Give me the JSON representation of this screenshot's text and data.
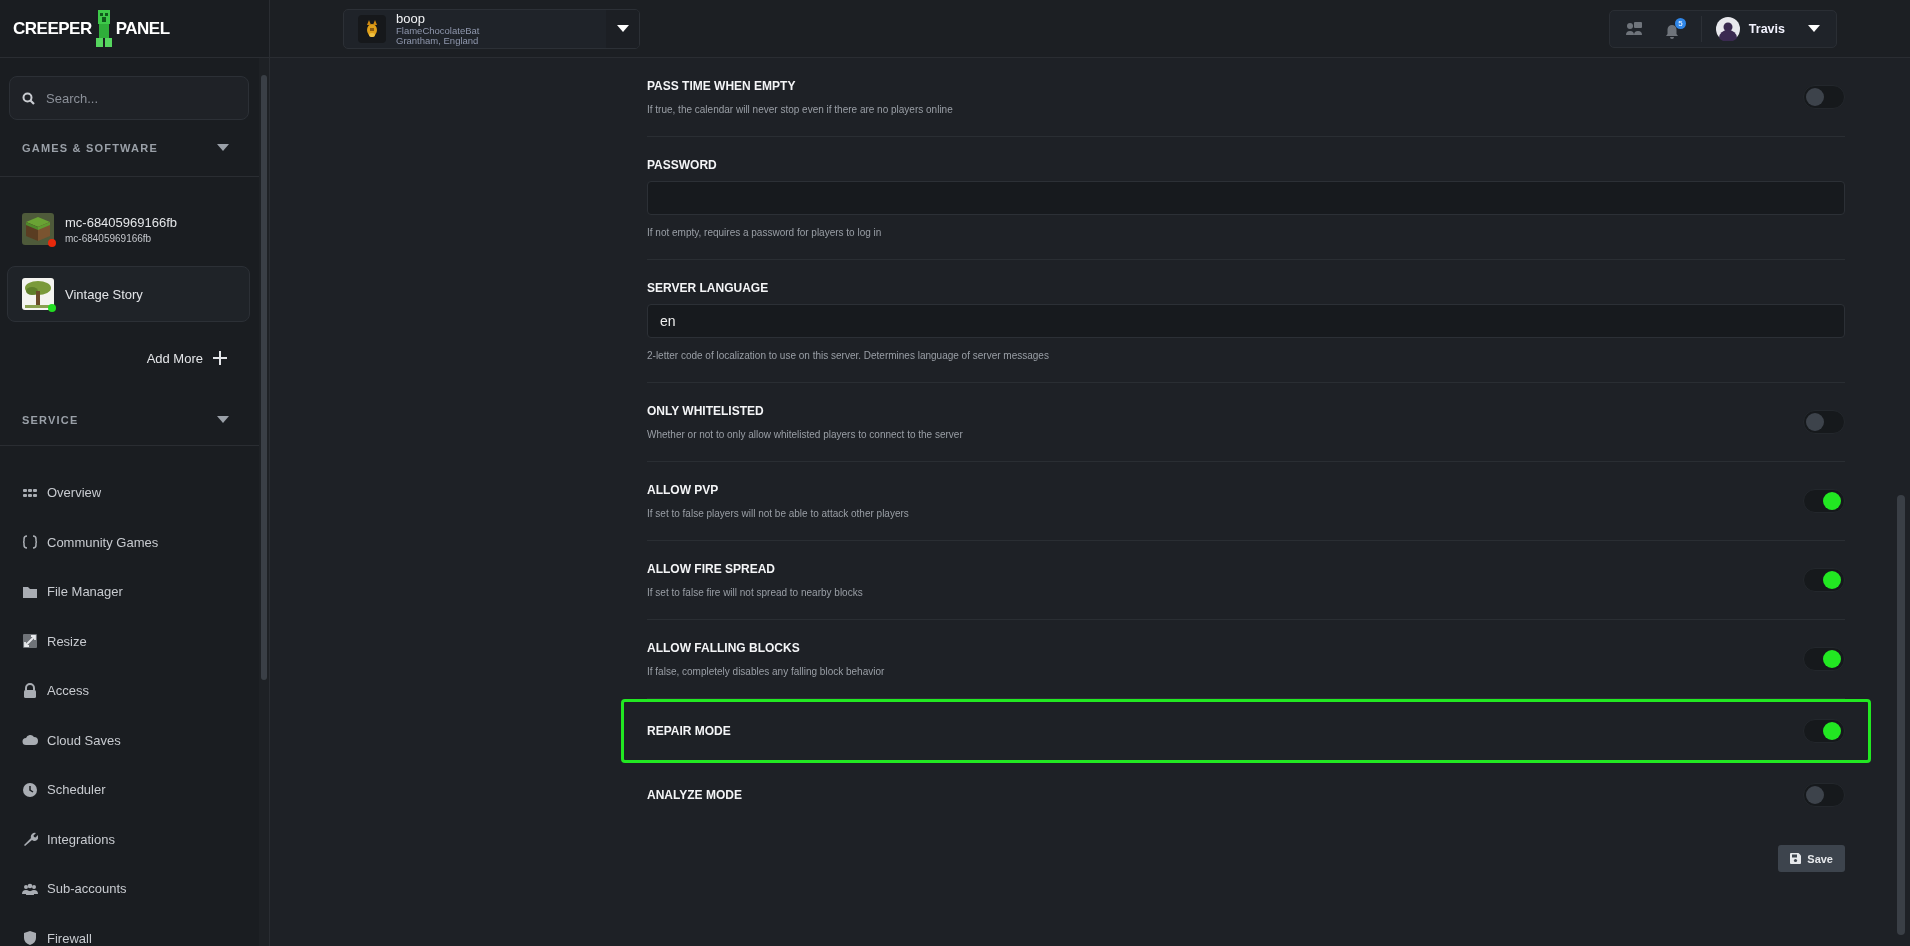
{
  "logo": {
    "left": "CREEPER",
    "right": "PANEL"
  },
  "sidebar": {
    "search": {
      "placeholder": "Search..."
    },
    "sections": [
      {
        "title": "GAMES & SOFTWARE",
        "expanded": true
      },
      {
        "title": "SERVICE",
        "expanded": true
      }
    ],
    "servers": [
      {
        "name": "mc-68405969166fb",
        "subtitle": "mc-68405969166fb",
        "color": "#e8290b",
        "selected": false
      },
      {
        "name": "Vintage Story",
        "color": "#22dd22",
        "selected": true
      }
    ],
    "add_more": "Add More",
    "nav": [
      {
        "label": "Overview"
      },
      {
        "label": "Community Games"
      },
      {
        "label": "File Manager"
      },
      {
        "label": "Resize"
      },
      {
        "label": "Access"
      },
      {
        "label": "Cloud Saves"
      },
      {
        "label": "Scheduler"
      },
      {
        "label": "Integrations"
      },
      {
        "label": "Sub-accounts"
      },
      {
        "label": "Firewall"
      }
    ]
  },
  "topbar": {
    "server": {
      "name": "boop",
      "owner": "FlameChocolateBat",
      "location": "Grantham, England"
    },
    "notifications": "5",
    "user": "Travis"
  },
  "settings": [
    {
      "kind": "toggle",
      "label": "PASS TIME WHEN EMPTY",
      "hint": "If true, the calendar will never stop even if there are no players online",
      "on": false,
      "highlighted": false
    },
    {
      "kind": "text",
      "label": "PASSWORD",
      "hint": "If not empty, requires a password for players to log in",
      "highlighted": false
    },
    {
      "kind": "text",
      "label": "SERVER LANGUAGE",
      "value": "en",
      "hint": "2-letter code of localization to use on this server. Determines language of server messages",
      "highlighted": false
    },
    {
      "kind": "toggle",
      "label": "ONLY WHITELISTED",
      "hint": "Whether or not to only allow whitelisted players to connect to the server",
      "on": false,
      "highlighted": false
    },
    {
      "kind": "toggle",
      "label": "ALLOW PVP",
      "hint": "If set to false players will not be able to attack other players",
      "on": true,
      "highlighted": false
    },
    {
      "kind": "toggle",
      "label": "ALLOW FIRE SPREAD",
      "hint": "If set to false fire will not spread to nearby blocks",
      "on": true,
      "highlighted": false
    },
    {
      "kind": "toggle",
      "label": "ALLOW FALLING BLOCKS",
      "hint": "If false, completely disables any falling block behavior",
      "on": true,
      "highlighted": false
    },
    {
      "kind": "toggle",
      "label": "REPAIR MODE",
      "on": true,
      "highlighted": true
    },
    {
      "kind": "toggle",
      "label": "ANALYZE MODE",
      "on": false,
      "highlighted": false
    }
  ],
  "save_button": "Save"
}
